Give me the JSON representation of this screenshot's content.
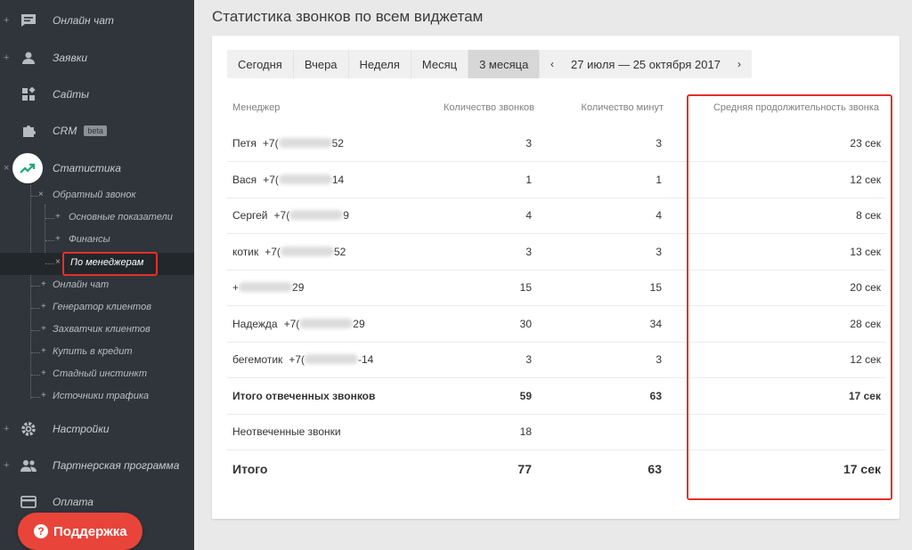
{
  "sidebar": {
    "main_items": [
      {
        "label": "Онлайн чат",
        "icon": "chat-icon",
        "sign": "+"
      },
      {
        "label": "Заявки",
        "icon": "user-icon",
        "sign": "+"
      },
      {
        "label": "Сайты",
        "icon": "widgets-icon",
        "sign": ""
      },
      {
        "label": "CRM",
        "icon": "puzzle-icon",
        "sign": "",
        "badge": "beta"
      },
      {
        "label": "Статистика",
        "icon": "trend-icon",
        "sign": "×"
      },
      {
        "label": "Настройки",
        "icon": "gear-icon",
        "sign": "+"
      },
      {
        "label": "Партнерская программа",
        "icon": "people-icon",
        "sign": "+"
      },
      {
        "label": "Оплата",
        "icon": "card-icon",
        "sign": ""
      }
    ],
    "sub_items": [
      {
        "label": "Обратный звонок"
      },
      {
        "label": "Основные показатели"
      },
      {
        "label": "Финансы"
      },
      {
        "label": "По менеджерам"
      },
      {
        "label": "Онлайн чат"
      },
      {
        "label": "Генератор клиентов"
      },
      {
        "label": "Захватчик клиентов"
      },
      {
        "label": "Купить в кредит"
      },
      {
        "label": "Стадный инстинкт"
      },
      {
        "label": "Источники трафика"
      }
    ],
    "support_label": "Поддержка"
  },
  "main": {
    "title": "Статистика звонков по всем виджетам",
    "tabs": [
      "Сегодня",
      "Вчера",
      "Неделя",
      "Месяц",
      "3 месяца"
    ],
    "active_tab": "3 месяца",
    "date_range": "27 июля — 25 октября 2017",
    "columns": [
      "Менеджер",
      "Количество звонков",
      "Количество минут",
      "Средняя продолжительность звонка"
    ],
    "rows": [
      {
        "name": "Петя",
        "phone_start": "+7(",
        "phone_end": "52",
        "calls": "3",
        "minutes": "3",
        "avg": "23 сек"
      },
      {
        "name": "Вася",
        "phone_start": "+7(",
        "phone_end": "14",
        "calls": "1",
        "minutes": "1",
        "avg": "12 сек"
      },
      {
        "name": "Сергей",
        "phone_start": "+7(",
        "phone_end": "9",
        "calls": "4",
        "minutes": "4",
        "avg": "8 сек"
      },
      {
        "name": "котик",
        "phone_start": "+7(",
        "phone_end": "52",
        "calls": "3",
        "minutes": "3",
        "avg": "13 сек"
      },
      {
        "name": "",
        "phone_start": "+",
        "phone_end": "29",
        "calls": "15",
        "minutes": "15",
        "avg": "20 сек"
      },
      {
        "name": "Надежда",
        "phone_start": "+7(",
        "phone_end": "29",
        "calls": "30",
        "minutes": "34",
        "avg": "28 сек"
      },
      {
        "name": "бегемотик",
        "phone_start": "+7(",
        "phone_end": "-14",
        "calls": "3",
        "minutes": "3",
        "avg": "12 сек"
      }
    ],
    "answered": {
      "label": "Итого отвеченных звонков",
      "calls": "59",
      "minutes": "63",
      "avg": "17 сек"
    },
    "unanswered": {
      "label": "Неотвеченные звонки",
      "calls": "18",
      "minutes": "",
      "avg": ""
    },
    "total": {
      "label": "Итого",
      "calls": "77",
      "minutes": "63",
      "avg": "17 сек"
    }
  },
  "colors": {
    "sidebar": "#2f353b",
    "accent_red": "#e3302b",
    "support": "#e8443a",
    "trend": "#1fa67a"
  }
}
